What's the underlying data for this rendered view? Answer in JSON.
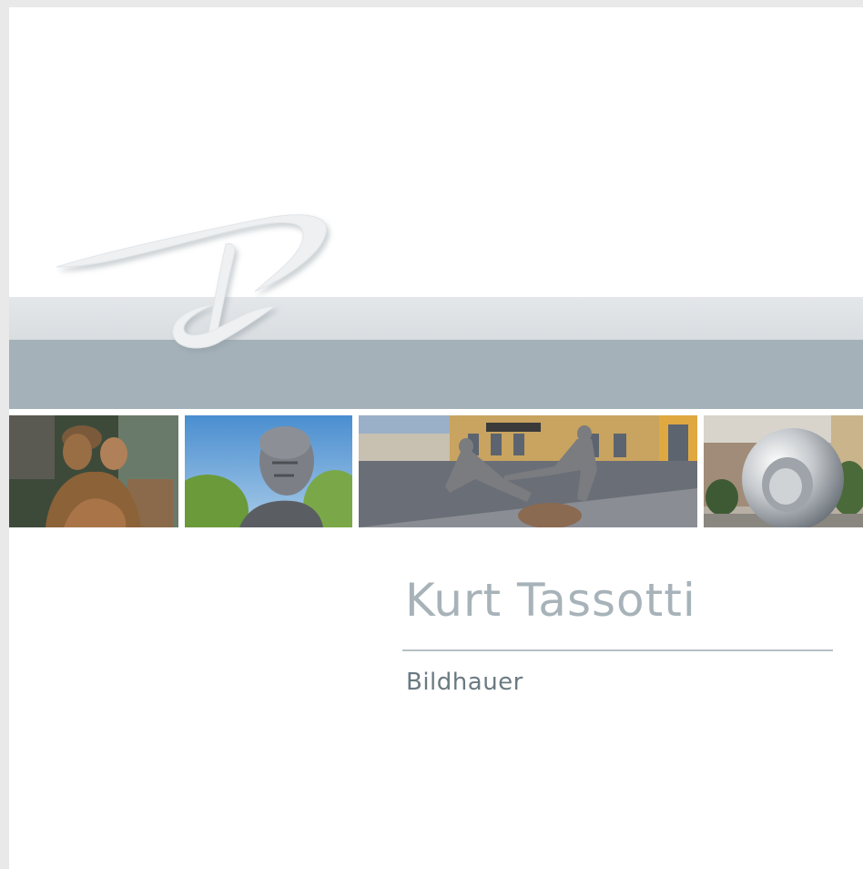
{
  "cover": {
    "name": "Kurt Tassotti",
    "profession": "Bildhauer"
  },
  "logo": {
    "icon": "tk-monogram-icon"
  },
  "colors": {
    "band_light": "#dde1e4",
    "band_dark": "#a4b1b8",
    "name_text": "#a7b3b9",
    "profession_text": "#6b7a82"
  },
  "photos": [
    {
      "icon": "bronze-couple-sculpture-photo"
    },
    {
      "icon": "bronze-bust-portrait-photo"
    },
    {
      "icon": "street-acrobat-sculpture-photo"
    },
    {
      "icon": "chrome-ring-sculpture-photo"
    }
  ]
}
